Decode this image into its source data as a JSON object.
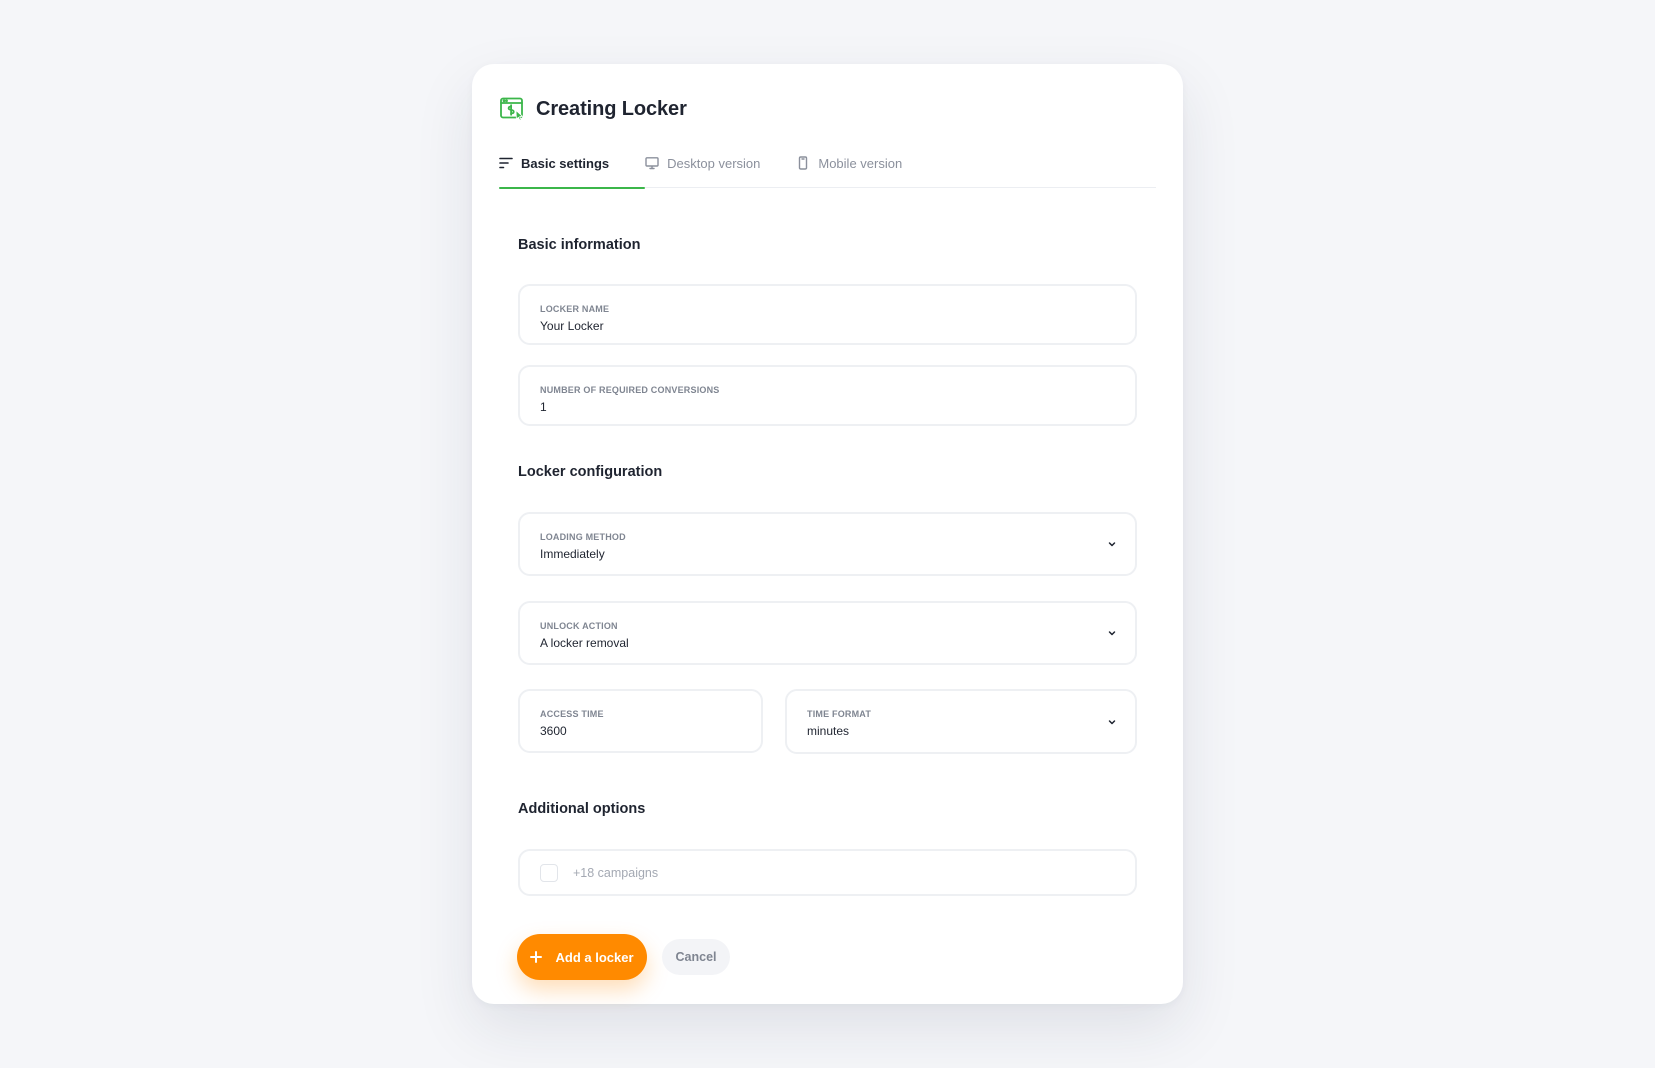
{
  "colors": {
    "accent_green": "#3bb64a",
    "primary_orange": "#ff8a00",
    "text_dark": "#1f2430",
    "text_muted": "#8b909c"
  },
  "header": {
    "icon": "locker-dollar-icon",
    "title": "Creating Locker"
  },
  "tabs": [
    {
      "label": "Basic settings",
      "icon": "sort-lines-icon",
      "active": true
    },
    {
      "label": "Desktop version",
      "icon": "monitor-icon",
      "active": false
    },
    {
      "label": "Mobile version",
      "icon": "phone-icon",
      "active": false
    }
  ],
  "sections": {
    "basic_information": "Basic information",
    "locker_configuration": "Locker configuration",
    "additional_options": "Additional options"
  },
  "fields": {
    "locker_name": {
      "label": "LOCKER NAME",
      "value": "Your Locker"
    },
    "required_conversions": {
      "label": "NUMBER OF REQUIRED CONVERSIONS",
      "value": "1"
    },
    "loading_method": {
      "label": "LOADING METHOD",
      "value": "Immediately"
    },
    "unlock_action": {
      "label": "UNLOCK ACTION",
      "value": "A locker removal"
    },
    "access_time": {
      "label": "ACCESS TIME",
      "value": "3600"
    },
    "time_format": {
      "label": "TIME FORMAT",
      "value": "minutes"
    }
  },
  "additional": {
    "campaigns_label": "+18 campaigns",
    "checked": false
  },
  "buttons": {
    "add_label": "Add a locker",
    "cancel_label": "Cancel"
  }
}
